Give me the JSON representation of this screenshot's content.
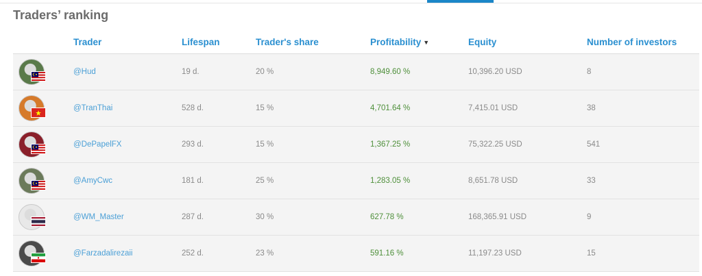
{
  "page": {
    "title": "Traders’ ranking"
  },
  "table": {
    "headers": {
      "trader": "Trader",
      "lifespan": "Lifespan",
      "share": "Trader's share",
      "profitability": "Profitability",
      "equity": "Equity",
      "investors": "Number of investors"
    },
    "sort_icon": "caret-down-icon",
    "rows": [
      {
        "name": "@Hud",
        "lifespan": "19 d.",
        "share": "20 %",
        "profit": "8,949.60 %",
        "equity": "10,396.20 USD",
        "investors": "8",
        "flag": "malaysia",
        "avatar_color": "#5a7a4a"
      },
      {
        "name": "@TranThai",
        "lifespan": "528 d.",
        "share": "15 %",
        "profit": "4,701.64 %",
        "equity": "7,415.01 USD",
        "investors": "38",
        "flag": "vietnam",
        "avatar_color": "#d67a2a"
      },
      {
        "name": "@DePapelFX",
        "lifespan": "293 d.",
        "share": "15 %",
        "profit": "1,367.25 %",
        "equity": "75,322.25 USD",
        "investors": "541",
        "flag": "malaysia",
        "avatar_color": "#8a1f2a"
      },
      {
        "name": "@AmyCwc",
        "lifespan": "181 d.",
        "share": "25 %",
        "profit": "1,283.05 %",
        "equity": "8,651.78 USD",
        "investors": "33",
        "flag": "malaysia",
        "avatar_color": "#6b7a5a"
      },
      {
        "name": "@WM_Master",
        "lifespan": "287 d.",
        "share": "30 %",
        "profit": "627.78 %",
        "equity": "168,365.91 USD",
        "investors": "9",
        "flag": "thailand",
        "avatar_color": "#e8e8e8"
      },
      {
        "name": "@Farzadalirezaii",
        "lifespan": "252 d.",
        "share": "23 %",
        "profit": "591.16 %",
        "equity": "11,197.23 USD",
        "investors": "15",
        "flag": "iran",
        "avatar_color": "#4a4a4a"
      }
    ]
  }
}
